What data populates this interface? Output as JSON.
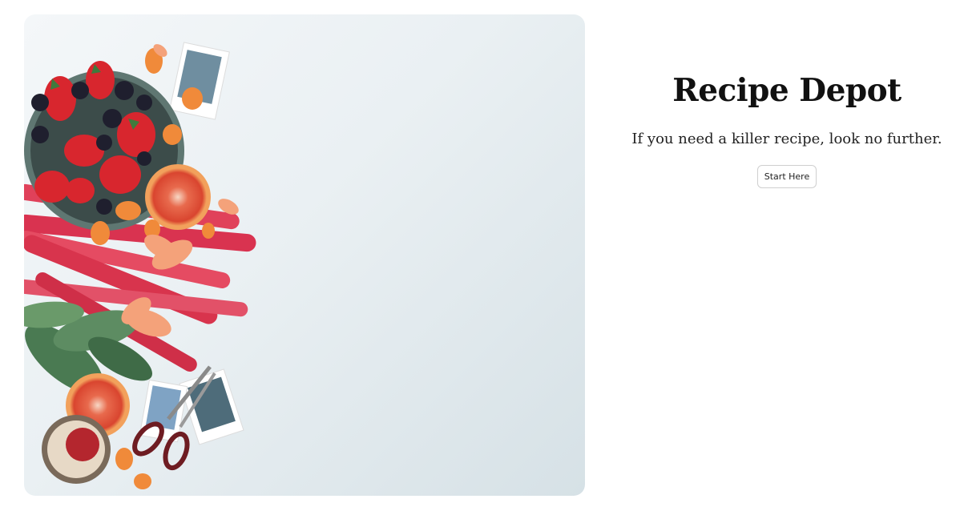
{
  "hero": {
    "title": "Recipe Depot",
    "tagline": "If you need a killer recipe, look no further.",
    "cta_label": "Start Here"
  },
  "hero_image": {
    "subject": "flat-lay of strawberries, blackberries, blood orange, rhubarb, flowers, scissors and photos",
    "colors": {
      "background": "#eef3f5",
      "rhubarb": "#e0415a",
      "strawberry": "#d8262e",
      "orange": "#f08a3a",
      "leaf": "#4a7a52"
    }
  }
}
